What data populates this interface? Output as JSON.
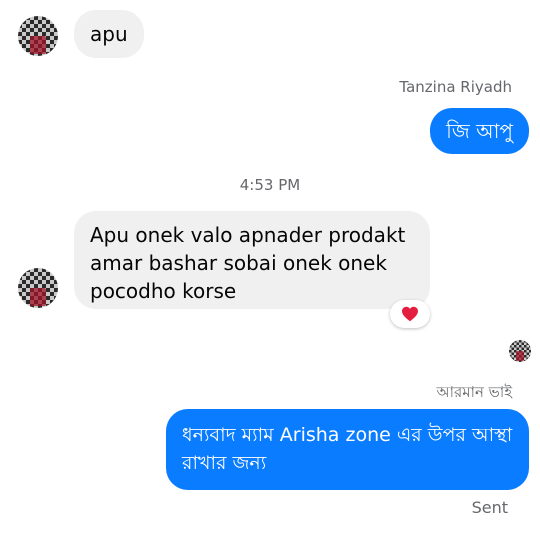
{
  "messages": [
    {
      "text": "apu"
    },
    {
      "sender": "Tanzina Riyadh",
      "text": "জি আপু"
    },
    {
      "timestamp": "4:53 PM",
      "text": "Apu onek valo apnader prodakt amar bashar sobai onek onek pocodho korse",
      "reaction": "heart-icon"
    },
    {
      "sender": "আরমান ভাই",
      "text": "ধন্যবাদ ম্যাম Arisha zone  এর উপর আস্থা রাখার জন্য",
      "status": "Sent"
    }
  ],
  "colors": {
    "outgoing_bubble": "#0a7cff",
    "incoming_bubble": "#f0f0f0",
    "meta_text": "#65676b",
    "reaction_heart": "#e41e3f"
  }
}
